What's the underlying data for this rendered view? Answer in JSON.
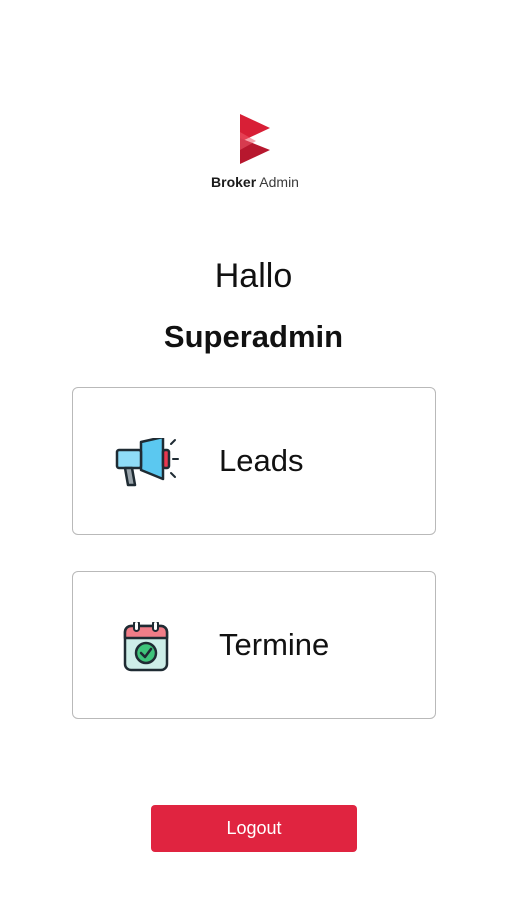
{
  "app": {
    "brand_bold": "Broker",
    "brand_light": "Admin",
    "accent_color": "#e02440"
  },
  "welcome": {
    "greeting": "Hallo",
    "user_name": "Superadmin"
  },
  "menu": [
    {
      "label": "Leads",
      "icon": "megaphone-icon"
    },
    {
      "label": "Termine",
      "icon": "calendar-check-icon"
    }
  ],
  "actions": {
    "logout_label": "Logout"
  }
}
